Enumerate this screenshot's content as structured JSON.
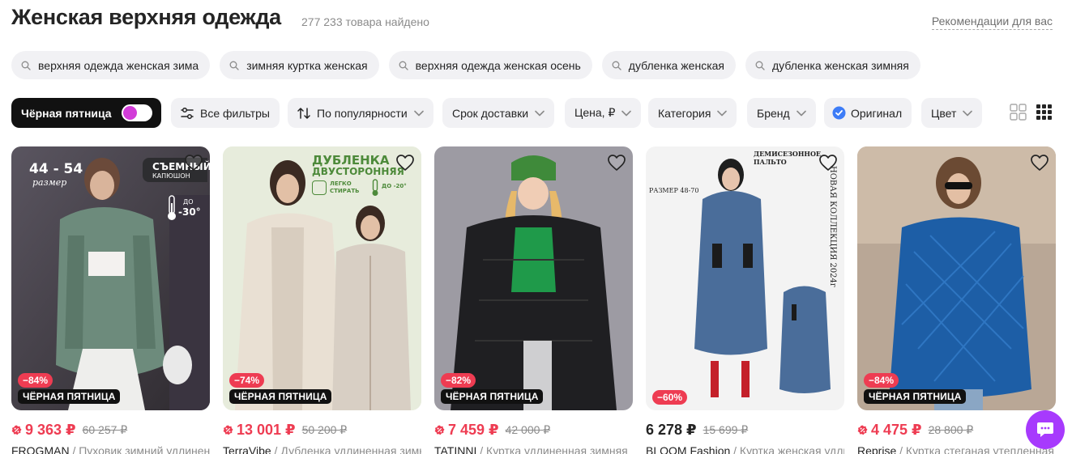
{
  "header": {
    "title": "Женская верхняя одежда",
    "found": "277 233 товара найдено",
    "recommendations": "Рекомендации для вас"
  },
  "chips": [
    {
      "label": "верхняя одежда женская зима",
      "icon": "search-icon"
    },
    {
      "label": "зимняя куртка женская",
      "icon": "search-icon"
    },
    {
      "label": "верхняя одежда женская осень",
      "icon": "search-icon"
    },
    {
      "label": "дубленка женская",
      "icon": "search-icon"
    },
    {
      "label": "дубленка женская зимняя",
      "icon": "search-icon"
    }
  ],
  "filters": {
    "black_friday": {
      "label": "Чёрная пятница",
      "enabled": true,
      "accent": "#d23cd8"
    },
    "all_filters": "Все фильтры",
    "sort": "По популярности",
    "delivery": "Срок доставки",
    "price": "Цена, ₽",
    "category": "Категория",
    "brand": "Бренд",
    "original": "Оригинал",
    "color": "Цвет"
  },
  "colors": {
    "sale": "#ee3c52",
    "brand_accent": "#a73afd",
    "chip_bg": "#f1f1f4",
    "check_blue": "#3d7cf7"
  },
  "products": [
    {
      "brand": "FROGMAN",
      "title": " / Пуховик зимний удлиненный",
      "price": "9 363 ₽",
      "old_price": "60 257 ₽",
      "discount": "−84%",
      "badge": "ЧЁРНАЯ ПЯТНИЦА",
      "sale_price": true,
      "overlay": {
        "size_label": "44 - 54",
        "size_word": "размер",
        "hood": "СЪЕМНЫЙ",
        "hood2": "КАПЮШОН",
        "temp_prefix": "ДО",
        "temp": "-30°"
      }
    },
    {
      "brand": "TerraVibe",
      "title": " / Дубленка удлиненная зимняя",
      "price": "13 001 ₽",
      "old_price": "50 200 ₽",
      "discount": "−74%",
      "badge": "ЧЁРНАЯ ПЯТНИЦА",
      "sale_price": true,
      "overlay": {
        "line1": "ДУБЛЕНКА",
        "line2": "ДВУСТОРОННЯЯ",
        "wash1": "ЛЕГКО",
        "wash2": "СТИРАТЬ",
        "temp": "ДО -20°"
      }
    },
    {
      "brand": "TATINNI",
      "title": " / Куртка удлиненная зимняя",
      "price": "7 459 ₽",
      "old_price": "42 000 ₽",
      "discount": "−82%",
      "badge": "ЧЁРНАЯ ПЯТНИЦА",
      "sale_price": true,
      "overlay": {}
    },
    {
      "brand": "BLOOM Fashion",
      "title": " / Куртка женская удлиненная",
      "price": "6 278 ₽",
      "old_price": "15 699 ₽",
      "discount": "−60%",
      "badge": "",
      "sale_price": false,
      "overlay": {
        "top": "ДЕМИСЕЗОННОЕ ПАЛЬТО",
        "size": "РАЗМЕР 48-70",
        "vertical": "НОВАЯ КОЛЛЕКЦИЯ 2024г"
      }
    },
    {
      "brand": "Reprise",
      "title": " / Куртка стеганая утепленная",
      "price": "4 475 ₽",
      "old_price": "28 800 ₽",
      "discount": "−84%",
      "badge": "ЧЁРНАЯ ПЯТНИЦА",
      "sale_price": true,
      "overlay": {}
    }
  ]
}
